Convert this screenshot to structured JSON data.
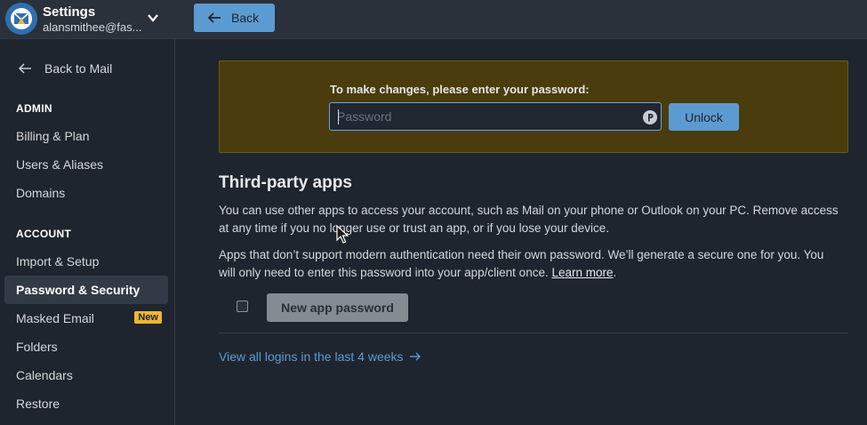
{
  "header": {
    "app_title": "Settings",
    "account_email": "alansmithee@fas...",
    "back_button_label": "Back"
  },
  "sidebar": {
    "back_to_mail": "Back to Mail",
    "admin_heading": "ADMIN",
    "admin_items": [
      "Billing & Plan",
      "Users & Aliases",
      "Domains"
    ],
    "account_heading": "ACCOUNT",
    "account_items": [
      {
        "label": "Import & Setup"
      },
      {
        "label": "Password & Security",
        "active": true
      },
      {
        "label": "Masked Email",
        "badge": "New"
      },
      {
        "label": "Folders"
      },
      {
        "label": "Calendars"
      },
      {
        "label": "Restore"
      }
    ]
  },
  "unlock": {
    "prompt": "To make changes, please enter your password:",
    "password_value": "",
    "password_placeholder": "Password",
    "unlock_button": "Unlock"
  },
  "third_party": {
    "title": "Third-party apps",
    "paragraph1": "You can use other apps to access your account, such as Mail on your phone or Outlook on your PC. Remove access at any time if you no longer use or trust an app, or if you lose your device.",
    "paragraph2_text": "Apps that don’t support modern authentication need their own password. We’ll generate a secure one for you. You will only need to enter this password into your app/client once.",
    "learn_more": "Learn more",
    "paragraph2_end": ".",
    "new_app_password_button": "New app password",
    "view_logins_link": "View all logins in the last 4 weeks"
  },
  "colors": {
    "accent": "#5b9bd2",
    "unlock_panel": "#4a3c0c",
    "badge": "#f0b72f",
    "background": "#1f252e"
  },
  "icons": {
    "logo": "fastmail-logo-icon",
    "account_menu": "chevron-down-icon",
    "back": "arrow-left-icon",
    "password_manager": "password-manager-icon",
    "link_arrow": "arrow-right-icon",
    "cursor": "mouse-pointer-icon"
  }
}
